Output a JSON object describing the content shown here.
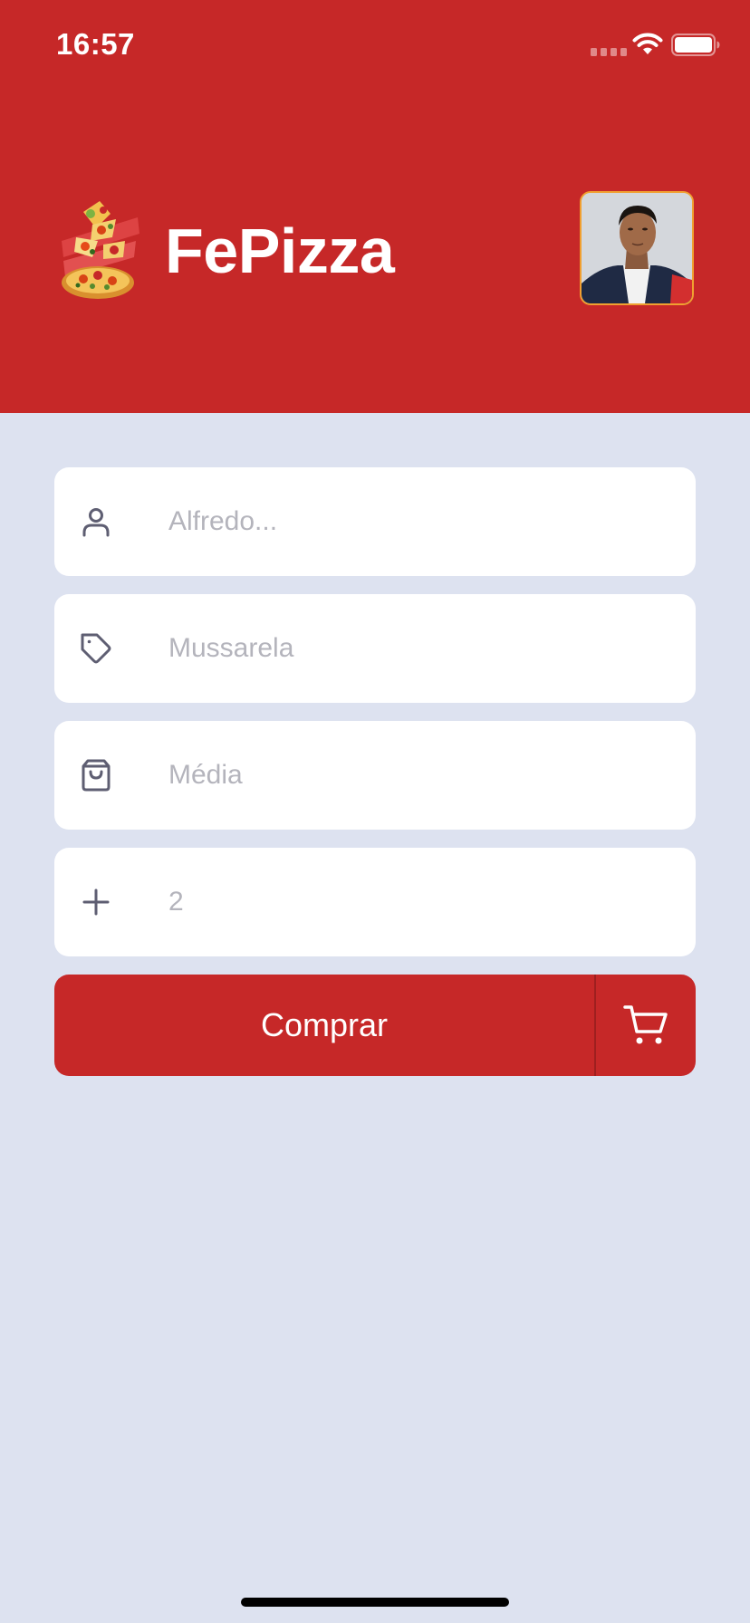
{
  "status_bar": {
    "time": "16:57",
    "icons": [
      "cellular-signal-icon",
      "wifi-icon",
      "battery-icon"
    ]
  },
  "header": {
    "logo_icon": "pizza-logo-icon",
    "title": "FePizza",
    "avatar": "user-avatar-photo"
  },
  "form": {
    "fields": [
      {
        "icon": "user-icon",
        "placeholder": "Alfredo..."
      },
      {
        "icon": "tag-icon",
        "placeholder": "Mussarela"
      },
      {
        "icon": "shopping-bag-icon",
        "placeholder": "Média"
      },
      {
        "icon": "plus-icon",
        "placeholder": "2"
      }
    ],
    "buy_label": "Comprar",
    "cart_icon": "shopping-cart-icon"
  },
  "colors": {
    "primary": "#c62828",
    "background": "#dde2f0",
    "field_background": "#ffffff",
    "placeholder": "#b4b4bc",
    "icon": "#5e5e72",
    "avatar_border": "#f0a030"
  }
}
